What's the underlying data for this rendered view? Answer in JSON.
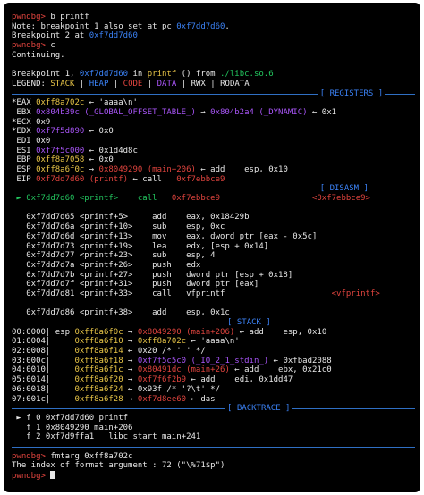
{
  "colors": {
    "background": "#000000",
    "text": "#e8e8e8",
    "prompt": "#e0443e",
    "address": "#3b82f6",
    "code": "#e0443e",
    "data": "#a855f7",
    "rwx": "#e8e8e8",
    "rodata": "#e8e8e8",
    "stack": "#e8c547",
    "heap": "#3b82f6",
    "green": "#22c55e",
    "rule": "#2f6fc4",
    "gray": "#8a8a8a"
  },
  "lines": [
    [
      [
        "pwndbg>",
        "prompt"
      ],
      [
        " b printf",
        "text"
      ]
    ],
    [
      [
        "Note: breakpoint 1 also set at pc ",
        "text"
      ],
      [
        "0xf7dd7d60",
        "address"
      ],
      [
        ".",
        "text"
      ]
    ],
    [
      [
        "Breakpoint 2 at ",
        "text"
      ],
      [
        "0xf7dd7d60",
        "address"
      ]
    ],
    [
      [
        "pwndbg>",
        "prompt"
      ],
      [
        " c",
        "text"
      ]
    ],
    [
      [
        "Continuing.",
        "text"
      ]
    ],
    [
      [
        "",
        "text"
      ]
    ],
    [
      [
        "Breakpoint 1, ",
        "text"
      ],
      [
        "0xf7dd7d60",
        "address"
      ],
      [
        " in ",
        "text"
      ],
      [
        "printf",
        "stack"
      ],
      [
        " () from ",
        "text"
      ],
      [
        "./libc.so.6",
        "green"
      ]
    ],
    [
      [
        "LEGEND: ",
        "text"
      ],
      [
        "STACK",
        "stack"
      ],
      [
        " | ",
        "text"
      ],
      [
        "HEAP",
        "heap"
      ],
      [
        " | ",
        "text"
      ],
      [
        "CODE",
        "code"
      ],
      [
        " | ",
        "text"
      ],
      [
        "DATA",
        "data"
      ],
      [
        " | ",
        "text"
      ],
      [
        "RWX",
        "rwx"
      ],
      [
        " | ",
        "text"
      ],
      [
        "RODATA",
        "rodata"
      ]
    ],
    {
      "rule": "[ REGISTERS ]",
      "pos": 0.76
    },
    [
      [
        "*EAX ",
        "text"
      ],
      [
        "0xff8a702c",
        "stack"
      ],
      [
        " ← 'aaaa\\n'",
        "text"
      ]
    ],
    [
      [
        " EBX ",
        "text"
      ],
      [
        "0x804b39c (_GLOBAL_OFFSET_TABLE_)",
        "data"
      ],
      [
        " → ",
        "text"
      ],
      [
        "0x804b2a4 (_DYNAMIC)",
        "data"
      ],
      [
        " ← 0x1",
        "text"
      ]
    ],
    [
      [
        "*ECX ",
        "text"
      ],
      [
        "0x9",
        "text"
      ]
    ],
    [
      [
        "*EDX ",
        "text"
      ],
      [
        "0xf7f5d890",
        "data"
      ],
      [
        " ← 0x0",
        "text"
      ]
    ],
    [
      [
        " EDI ",
        "text"
      ],
      [
        "0x0",
        "text"
      ]
    ],
    [
      [
        " ESI ",
        "text"
      ],
      [
        "0xf7f5c000",
        "data"
      ],
      [
        " ← 0x1d4d8c",
        "text"
      ]
    ],
    [
      [
        " EBP ",
        "text"
      ],
      [
        "0xff8a7058",
        "stack"
      ],
      [
        " ← 0x0",
        "text"
      ]
    ],
    [
      [
        " ESP ",
        "text"
      ],
      [
        "0xff8a6f0c",
        "stack"
      ],
      [
        " → ",
        "text"
      ],
      [
        "0x8049290 (main+206)",
        "code"
      ],
      [
        " ← add    esp, 0x10",
        "text"
      ]
    ],
    [
      [
        " EIP ",
        "text"
      ],
      [
        "0xf7dd7d60 (printf)",
        "code"
      ],
      [
        " ← call   ",
        "text"
      ],
      [
        "0xf7ebbce9",
        "code"
      ]
    ],
    {
      "rule": "[ DISASM ]",
      "pos": 0.76
    },
    [
      [
        " ► 0xf7dd7d60 <printf>    call   ",
        "green"
      ],
      [
        "0xf7ebbce9",
        "code"
      ],
      [
        "                   <0xf7ebbce9>",
        "code"
      ]
    ],
    [
      [
        "",
        "text"
      ]
    ],
    [
      [
        "   0xf7dd7d65 <printf+5>     add    eax, 0x18429b",
        "text"
      ]
    ],
    [
      [
        "   0xf7dd7d6a <printf+10>    sub    esp, 0xc",
        "text"
      ]
    ],
    [
      [
        "   0xf7dd7d6d <printf+13>    mov    eax, dword ptr [eax - 0x5c]",
        "text"
      ]
    ],
    [
      [
        "   0xf7dd7d73 <printf+19>    lea    edx, [esp + 0x14]",
        "text"
      ]
    ],
    [
      [
        "   0xf7dd7d77 <printf+23>    sub    esp, 4",
        "text"
      ]
    ],
    [
      [
        "   0xf7dd7d7a <printf+26>    push   edx",
        "text"
      ]
    ],
    [
      [
        "   0xf7dd7d7b <printf+27>    push   dword ptr [esp + 0x18]",
        "text"
      ]
    ],
    [
      [
        "   0xf7dd7d7f <printf+31>    push   dword ptr [eax]",
        "text"
      ]
    ],
    [
      [
        "   0xf7dd7d81 <printf+33>    call   vfprintf",
        "text"
      ],
      [
        "                      <vfprintf>",
        "code"
      ]
    ],
    [
      [
        "",
        "text"
      ]
    ],
    [
      [
        "   0xf7dd7d86 <printf+38>    add    esp, 0x1c",
        "text"
      ]
    ],
    {
      "rule": "[ STACK ]",
      "pos": 0.53
    },
    [
      [
        "00:0000│ esp ",
        "text"
      ],
      [
        "0xff8a6f0c",
        "stack"
      ],
      [
        " → ",
        "text"
      ],
      [
        "0x8049290 (main+206)",
        "code"
      ],
      [
        " ← add    esp, 0x10",
        "text"
      ]
    ],
    [
      [
        "01:0004│     ",
        "text"
      ],
      [
        "0xff8a6f10",
        "stack"
      ],
      [
        " → ",
        "text"
      ],
      [
        "0xff8a702c",
        "stack"
      ],
      [
        " ← 'aaaa\\n'",
        "text"
      ]
    ],
    [
      [
        "02:0008│     ",
        "text"
      ],
      [
        "0xff8a6f14",
        "stack"
      ],
      [
        " ← 0x20 /* ' ' */",
        "text"
      ]
    ],
    [
      [
        "03:000c│     ",
        "text"
      ],
      [
        "0xff8a6f18",
        "stack"
      ],
      [
        " → ",
        "text"
      ],
      [
        "0xf7f5c5c0 (_IO_2_1_stdin_)",
        "data"
      ],
      [
        " ← 0xfbad2088",
        "text"
      ]
    ],
    [
      [
        "04:0010│     ",
        "text"
      ],
      [
        "0xff8a6f1c",
        "stack"
      ],
      [
        " → ",
        "text"
      ],
      [
        "0x80491dc (main+26)",
        "code"
      ],
      [
        " ← add    ebx, 0x21c0",
        "text"
      ]
    ],
    [
      [
        "05:0014│     ",
        "text"
      ],
      [
        "0xff8a6f20",
        "stack"
      ],
      [
        " → ",
        "text"
      ],
      [
        "0xf7f6f2b9",
        "code"
      ],
      [
        " ← add    edi, 0x1dd47",
        "text"
      ]
    ],
    [
      [
        "06:0018│     ",
        "text"
      ],
      [
        "0xff8a6f24",
        "stack"
      ],
      [
        " ← 0x93f /* '?\\t' */",
        "text"
      ]
    ],
    [
      [
        "07:001c│     ",
        "text"
      ],
      [
        "0xff8a6f28",
        "stack"
      ],
      [
        " → ",
        "text"
      ],
      [
        "0xf7d8ee60",
        "code"
      ],
      [
        " ← das",
        "text"
      ]
    ],
    {
      "rule": "[ BACKTRACE ]",
      "pos": 0.53
    },
    [
      [
        " ► f 0 0xf7dd7d60 printf",
        "text"
      ]
    ],
    [
      [
        "   f 1 0x8049290 main+206",
        "text"
      ]
    ],
    [
      [
        "   f 2 0xf7d9ffa1 __libc_start_main+241",
        "text"
      ]
    ],
    {
      "rule": "",
      "pos": 0
    },
    [
      [
        "pwndbg>",
        "prompt"
      ],
      [
        " fmtarg 0xff8a702c",
        "text"
      ]
    ],
    [
      [
        "The index of format argument : 72 (\"\\%71$p\")",
        "text"
      ]
    ],
    [
      [
        "pwndbg>",
        "prompt"
      ],
      [
        " ",
        "text"
      ],
      {
        "cursor": true
      }
    ]
  ]
}
